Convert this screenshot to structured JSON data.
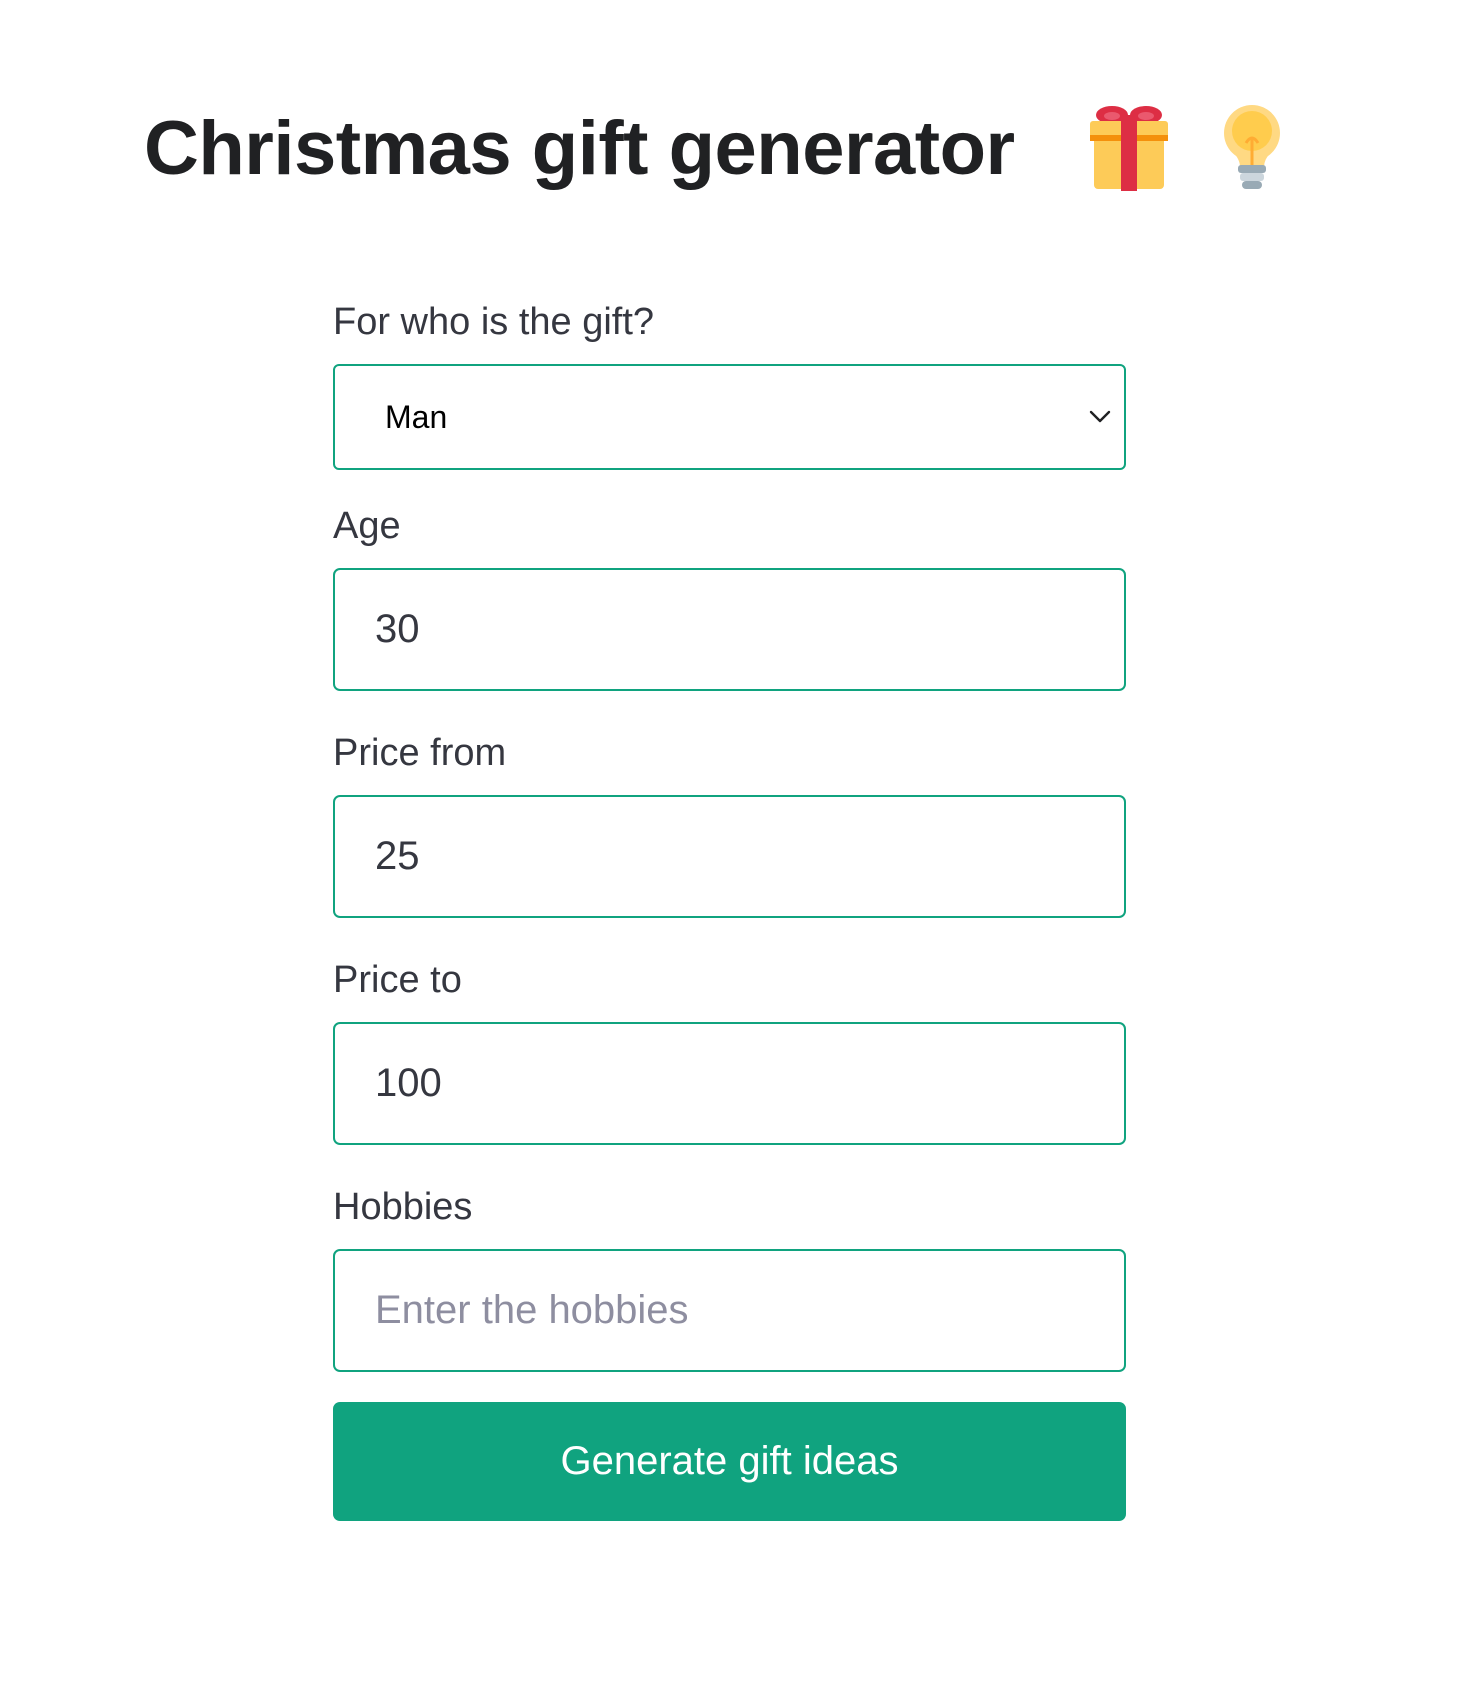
{
  "header": {
    "title": "Christmas gift generator",
    "icons": [
      "gift-icon",
      "light-bulb-icon"
    ]
  },
  "form": {
    "recipient": {
      "label": "For who is the gift?",
      "selected": "Man"
    },
    "age": {
      "label": "Age",
      "value": "30"
    },
    "price_from": {
      "label": "Price from",
      "value": "25"
    },
    "price_to": {
      "label": "Price to",
      "value": "100"
    },
    "hobbies": {
      "label": "Hobbies",
      "value": "",
      "placeholder": "Enter the hobbies"
    },
    "submit_label": "Generate gift ideas"
  },
  "colors": {
    "accent": "#10a37f",
    "text": "#202123",
    "placeholder": "#8e8ea0"
  }
}
